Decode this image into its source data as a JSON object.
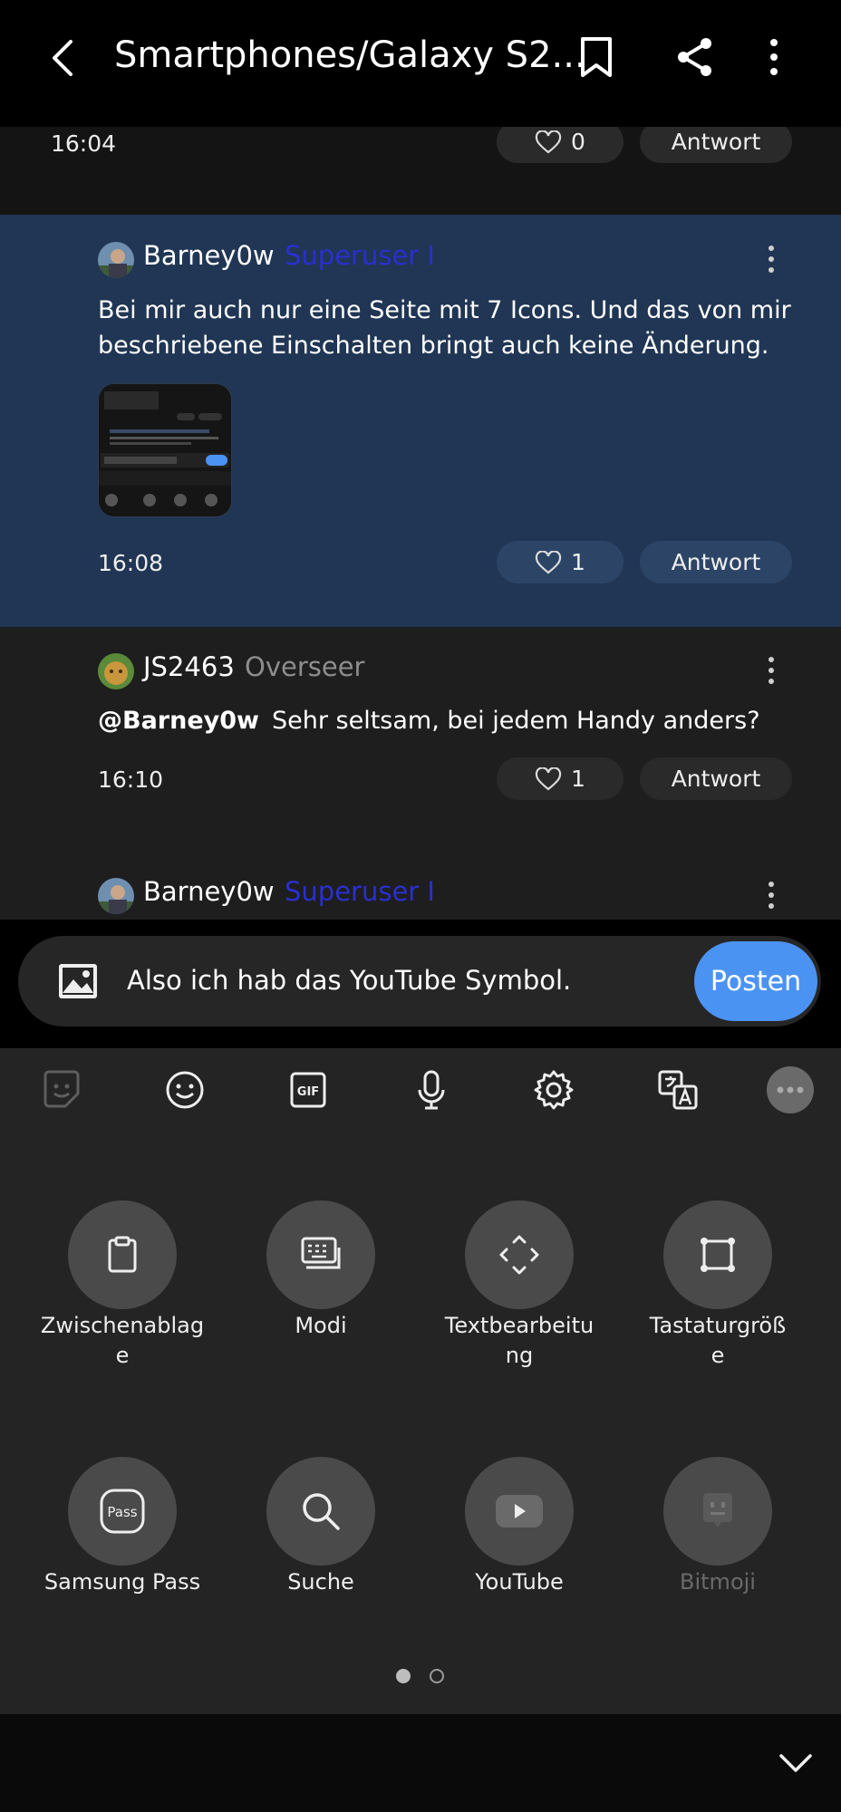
{
  "header": {
    "back_icon": "arrow-left-icon",
    "title": "Smartphones/Galaxy S2...",
    "bookmark_icon": "bookmark-icon",
    "share_icon": "share-icon",
    "more_icon": "more-vertical-icon"
  },
  "previous_post": {
    "time": "16:04",
    "likes": "0",
    "reply_label": "Antwort"
  },
  "posts": [
    {
      "username": "Barney0w",
      "rank": "Superuser I",
      "text": "Bei mir auch nur eine Seite mit 7 Icons. Und das von mir beschriebene Einschalten bringt auch keine Änderung.",
      "time": "16:08",
      "likes": "1",
      "reply_label": "Antwort"
    },
    {
      "username": "JS2463",
      "rank": "Overseer",
      "mention": "@Barney0w",
      "text": "Sehr seltsam, bei jedem Handy anders?",
      "time": "16:10",
      "likes": "1",
      "reply_label": "Antwort"
    },
    {
      "username": "Barney0w",
      "rank": "Superuser I"
    }
  ],
  "compose": {
    "image_icon": "image-icon",
    "text": "Also ich hab das YouTube Symbol.",
    "post_label": "Posten"
  },
  "keyboard_toolbar": [
    {
      "icon": "sticker-icon"
    },
    {
      "icon": "emoji-icon"
    },
    {
      "icon": "gif-icon",
      "label": "GIF"
    },
    {
      "icon": "microphone-icon"
    },
    {
      "icon": "settings-icon"
    },
    {
      "icon": "translate-icon"
    },
    {
      "icon": "more-horizontal-icon"
    }
  ],
  "keyboard_tools": [
    {
      "icon": "clipboard-icon",
      "label_line1": "Zwischenablag",
      "label_line2": "e"
    },
    {
      "icon": "keyboard-modes-icon",
      "label_line1": "Modi",
      "label_line2": ""
    },
    {
      "icon": "text-editing-icon",
      "label_line1": "Textbearbeitu",
      "label_line2": "ng"
    },
    {
      "icon": "keyboard-size-icon",
      "label_line1": "Tastaturgröß",
      "label_line2": "e"
    },
    {
      "icon": "samsung-pass-icon",
      "label_line1": "Samsung Pass",
      "label_line2": "",
      "glyph": "Pass"
    },
    {
      "icon": "search-icon",
      "label_line1": "Suche",
      "label_line2": ""
    },
    {
      "icon": "youtube-icon",
      "label_line1": "YouTube",
      "label_line2": ""
    },
    {
      "icon": "bitmoji-icon",
      "label_line1": "Bitmoji",
      "label_line2": ""
    }
  ],
  "pagination": {
    "pages": 2,
    "current": 1
  },
  "colors": {
    "accent_blue": "#4b93f2",
    "highlight_bg": "#203654",
    "rank_superuser": "#2a2fd0",
    "rank_overseer": "#8d8d8d"
  }
}
